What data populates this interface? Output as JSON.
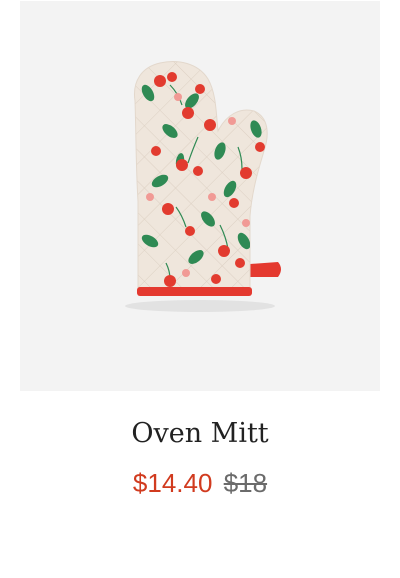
{
  "product": {
    "image_alt": "oven-mitt-cherry-print",
    "title": "Oven Mitt",
    "sale_price": "$14.40",
    "original_price": "$18"
  },
  "colors": {
    "sale_price": "#d13b1f",
    "original_price": "#6b6b6b",
    "image_background": "#f3f3f3",
    "mitt_fabric": "#efe6dc",
    "mitt_trim": "#e4392f",
    "cherry": "#e23b2f",
    "leaf": "#2f8a54"
  }
}
